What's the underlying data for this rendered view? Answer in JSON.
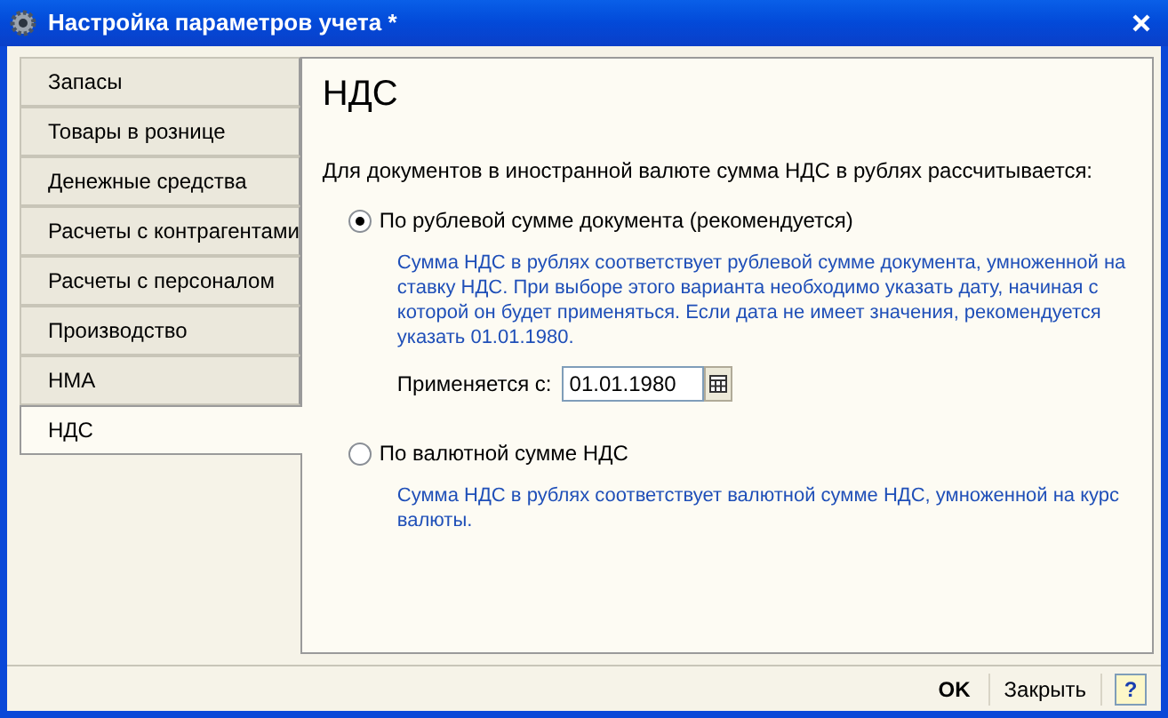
{
  "window": {
    "title": "Настройка параметров учета *"
  },
  "tabs": [
    {
      "label": "Запасы",
      "selected": false
    },
    {
      "label": "Товары в рознице",
      "selected": false
    },
    {
      "label": "Денежные средства",
      "selected": false
    },
    {
      "label": "Расчеты с контрагентами",
      "selected": false
    },
    {
      "label": "Расчеты с персоналом",
      "selected": false
    },
    {
      "label": "Производство",
      "selected": false
    },
    {
      "label": "НМА",
      "selected": false
    },
    {
      "label": "НДС",
      "selected": true
    }
  ],
  "panel": {
    "heading": "НДС",
    "question": "Для документов в иностранной валюте сумма НДС в рублях рассчитывается:",
    "options": [
      {
        "label": "По рублевой сумме документа (рекомендуется)",
        "selected": true,
        "description": "Сумма НДС в рублях соответствует рублевой сумме документа, умноженной на ставку НДС. При выборе этого варианта необходимо указать дату, начиная с которой он будет применяться. Если дата не имеет значения, рекомендуется указать 01.01.1980.",
        "date_label": "Применяется с:",
        "date_value": "01.01.1980"
      },
      {
        "label": "По валютной сумме НДС",
        "selected": false,
        "description": "Сумма НДС в рублях соответствует валютной сумме НДС, умноженной на курс валюты."
      }
    ]
  },
  "footer": {
    "ok": "OK",
    "close": "Закрыть",
    "help": "?"
  }
}
